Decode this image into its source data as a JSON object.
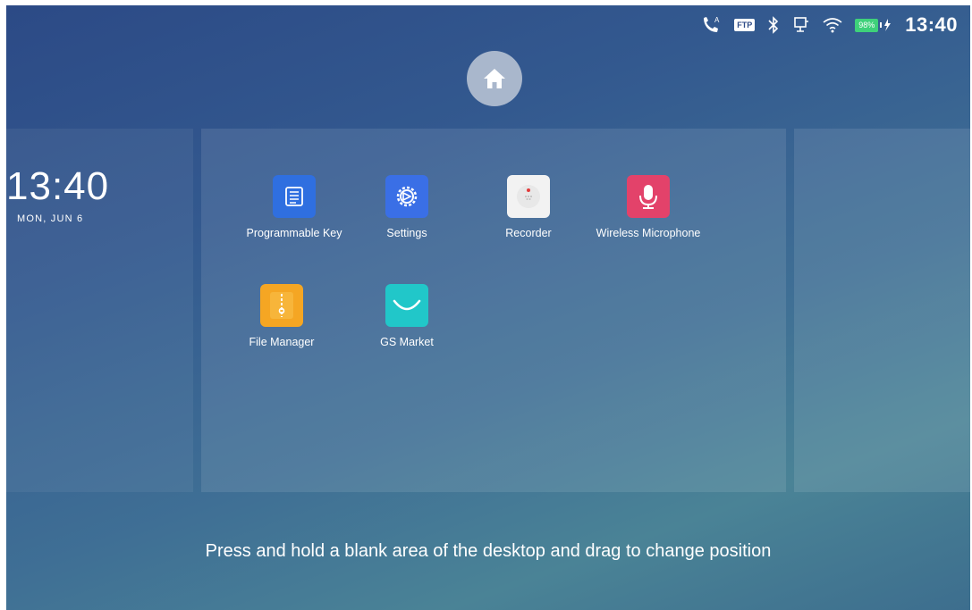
{
  "status_bar": {
    "ftp_label": "FTP",
    "battery_label": "98%",
    "time": "13:40"
  },
  "clock_widget": {
    "time": "13:40",
    "date": "MON, JUN 6"
  },
  "apps": [
    {
      "label": "Programmable Key",
      "icon": "programmable-key-icon",
      "color": "#2f6fe0"
    },
    {
      "label": "Settings",
      "icon": "settings-gear-icon",
      "color": "#3a6fe6"
    },
    {
      "label": "Recorder",
      "icon": "recorder-icon",
      "color": "#f2f2f2"
    },
    {
      "label": "Wireless Microphone",
      "icon": "microphone-icon",
      "color": "#e3426a"
    },
    {
      "label": "File Manager",
      "icon": "file-manager-icon",
      "color": "#f5a623"
    },
    {
      "label": "GS Market",
      "icon": "gs-market-icon",
      "color": "#21c7c9"
    }
  ],
  "hint": "Press and hold a blank area of the desktop and drag to change position"
}
